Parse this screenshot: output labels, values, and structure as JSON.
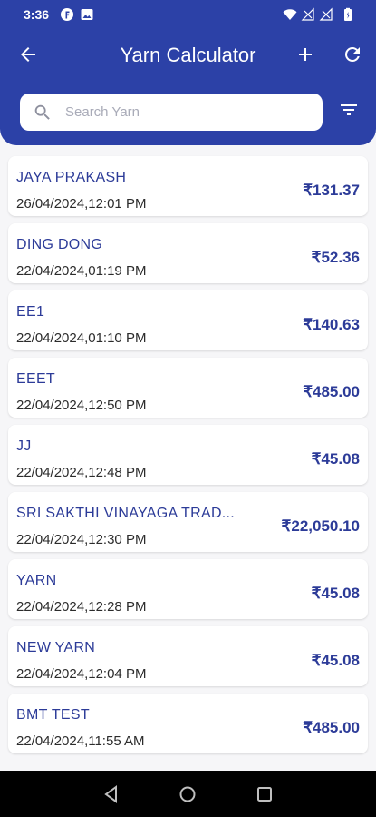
{
  "status_bar": {
    "time": "3:36",
    "left_icons": [
      "f-app-icon",
      "image-icon"
    ],
    "right_icons": [
      "wifi-icon",
      "signal-icon",
      "signal-icon",
      "battery-icon"
    ]
  },
  "app_bar": {
    "title": "Yarn Calculator",
    "back_icon": "arrow-left-icon",
    "add_icon": "plus-icon",
    "refresh_icon": "refresh-icon"
  },
  "search": {
    "placeholder": "Search Yarn",
    "value": "",
    "filter_icon": "filter-icon"
  },
  "items": [
    {
      "name": "JAYA PRAKASH",
      "date": "26/04/2024,12:01 PM",
      "amount": "₹131.37"
    },
    {
      "name": "DING DONG",
      "date": "22/04/2024,01:19 PM",
      "amount": "₹52.36"
    },
    {
      "name": "EE1",
      "date": "22/04/2024,01:10 PM",
      "amount": "₹140.63"
    },
    {
      "name": "EEET",
      "date": "22/04/2024,12:50 PM",
      "amount": "₹485.00"
    },
    {
      "name": "JJ",
      "date": "22/04/2024,12:48 PM",
      "amount": "₹45.08"
    },
    {
      "name": "SRI SAKTHI VINAYAGA TRAD...",
      "date": "22/04/2024,12:30 PM",
      "amount": "₹22,050.10"
    },
    {
      "name": "YARN",
      "date": "22/04/2024,12:28 PM",
      "amount": "₹45.08"
    },
    {
      "name": "NEW YARN",
      "date": "22/04/2024,12:04 PM",
      "amount": "₹45.08"
    },
    {
      "name": "BMT TEST",
      "date": "22/04/2024,11:55 AM",
      "amount": "₹485.00"
    }
  ],
  "colors": {
    "header": "#2c41a7",
    "accent_text": "#2c3b98",
    "background": "#f6f6f8"
  },
  "nav_bar": {
    "buttons": [
      "back-triangle-icon",
      "home-circle-icon",
      "recents-square-icon"
    ]
  }
}
